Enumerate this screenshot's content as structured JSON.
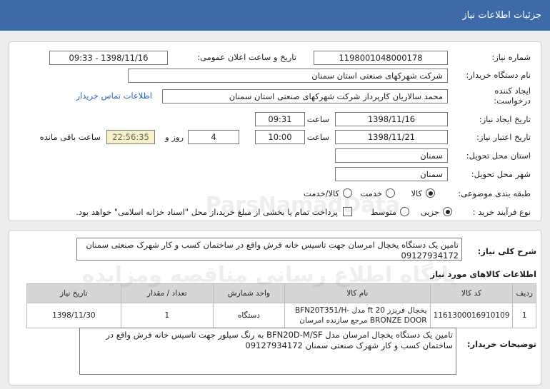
{
  "header": {
    "title": "جزئیات اطلاعات نیاز"
  },
  "details": {
    "need_number_label": "شماره نیاز:",
    "need_number": "1198001048000178",
    "announce_label": "تاریخ و ساعت اعلان عمومی:",
    "announce_value": "1398/11/16 - 09:33",
    "buyer_label": "نام دستگاه خریدار:",
    "buyer_value": "شرکت شهرکهای صنعتی استان سمنان",
    "creator_label_1": "ایجاد کننده",
    "creator_label_2": "درخواست:",
    "creator_value": "محمد سالاریان کارپرداز شرکت شهرکهای صنعتی استان سمنان",
    "contact_link": "اطلاعات تماس خریدار",
    "create_date_label": "تاریخ ایجاد نیاز:",
    "create_date": "1398/11/16",
    "time_label": "ساعت",
    "create_time": "09:31",
    "validity_label": "تاریخ اعتبار نیاز:",
    "validity_date": "1398/11/21",
    "validity_time": "10:00",
    "days_value": "4",
    "days_label": "روز و",
    "remaining_value": "22:56:35",
    "remaining_label": "ساعت باقی مانده",
    "province_label": "استان محل تحویل:",
    "province_value": "سمنان",
    "city_label": "شهر محل تحویل:",
    "city_value": "سمنان",
    "category_label": "طبقه بندی موضوعی:",
    "category_options": [
      "کالا",
      "خدمت",
      "کالا/خدمت"
    ],
    "process_label": "نوع فرآیند خرید :",
    "process_options": [
      "جزیی",
      "متوسط"
    ],
    "payment_note": "پرداخت تمام یا بخشی از مبلغ خرید،از محل \"اسناد خزانه اسلامی\" خواهد بود."
  },
  "summary": {
    "label": "شرح کلی نیاز:",
    "text": "تامین یک دستگاه یخچال امرسان جهت تاسیس خانه فرش واقع در ساختمان کسب و کار شهرک صنعتی سمنان 09127934172"
  },
  "goods": {
    "title": "اطلاعات کالاهای مورد نیاز",
    "columns": [
      "ردیف",
      "کد کالا",
      "نام کالا",
      "واحد شمارش",
      "تعداد / مقدار",
      "تاریخ نیاز"
    ],
    "rows": [
      {
        "index": "1",
        "code": "1161300016910109",
        "name": "یخچال فریزر 20 ft مدل BFN20T351/H-BRONZE DOOR مرجع سازنده امرسان",
        "unit": "دستگاه",
        "qty": "1",
        "date": "1398/11/30"
      }
    ]
  },
  "buyer_notes": {
    "label": "توضیحات خریدار:",
    "text": "تامین یک دستگاه یخچال امرسان مدل BFN20D-M/SF به رنگ سیلور جهت تاسیس خانه فرش واقع در ساختمان کسب و کار شهرک صنعتی سمنان 09127934172"
  },
  "watermark": {
    "line1": "پایگاه اطلاع رسانی مناقصه ومزایده",
    "line2": "ParsNamadData"
  }
}
